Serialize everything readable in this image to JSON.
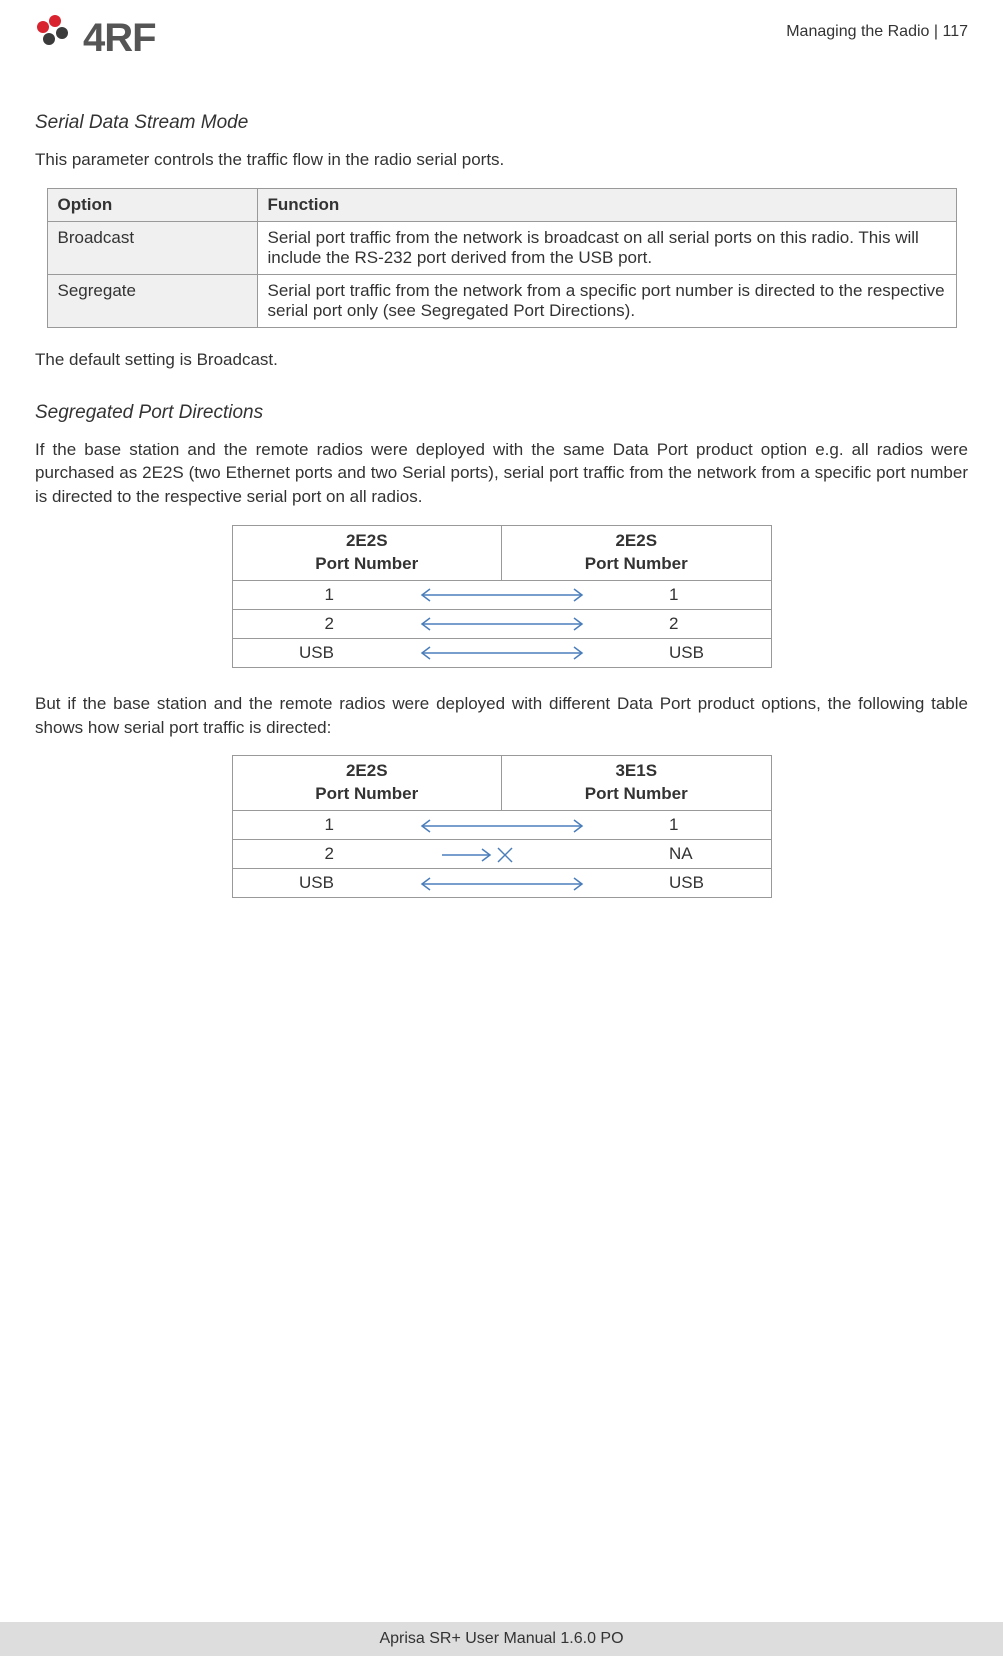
{
  "header": {
    "logo_text": "4RF",
    "section": "Managing the Radio",
    "page": "117",
    "separator": "  |  "
  },
  "sec1": {
    "title": "Serial Data Stream Mode",
    "intro": "This parameter controls the traffic flow in the radio serial ports.",
    "table": {
      "headers": [
        "Option",
        "Function"
      ],
      "rows": [
        {
          "option": "Broadcast",
          "function": "Serial port traffic from the network is broadcast on all serial ports on this radio. This will include the RS-232 port derived from the USB port."
        },
        {
          "option": "Segregate",
          "function": "Serial port traffic from the network from a specific port number is directed to the respective serial port only (see Segregated Port Directions)."
        }
      ]
    },
    "default_text": "The default setting is Broadcast."
  },
  "sec2": {
    "title": "Segregated Port Directions",
    "intro": "If the base station and the remote radios were deployed with the same Data Port product option e.g. all radios were purchased as 2E2S (two Ethernet ports and two Serial ports), serial port traffic from the network from a specific port number is directed to the respective serial port on all radios.",
    "table1": {
      "left_model": "2E2S",
      "right_model": "2E2S",
      "port_number_label": "Port Number",
      "rows": [
        {
          "left": "1",
          "right": "1",
          "arrow": "bidirectional"
        },
        {
          "left": "2",
          "right": "2",
          "arrow": "bidirectional"
        },
        {
          "left": "USB",
          "right": "USB",
          "arrow": "bidirectional"
        }
      ]
    },
    "mid_text": "But if the base station and the remote radios were deployed with different Data Port product options, the following table shows how serial port traffic is directed:",
    "table2": {
      "left_model": "2E2S",
      "right_model": "3E1S",
      "port_number_label": "Port Number",
      "rows": [
        {
          "left": "1",
          "right": "1",
          "arrow": "bidirectional"
        },
        {
          "left": "2",
          "right": "NA",
          "arrow": "blocked"
        },
        {
          "left": "USB",
          "right": "USB",
          "arrow": "bidirectional"
        }
      ]
    }
  },
  "footer": {
    "text": "Aprisa SR+ User Manual 1.6.0 PO"
  },
  "colors": {
    "arrow_blue": "#4A7EBB",
    "logo_red": "#D9232E",
    "logo_dark": "#3B3B3B"
  }
}
